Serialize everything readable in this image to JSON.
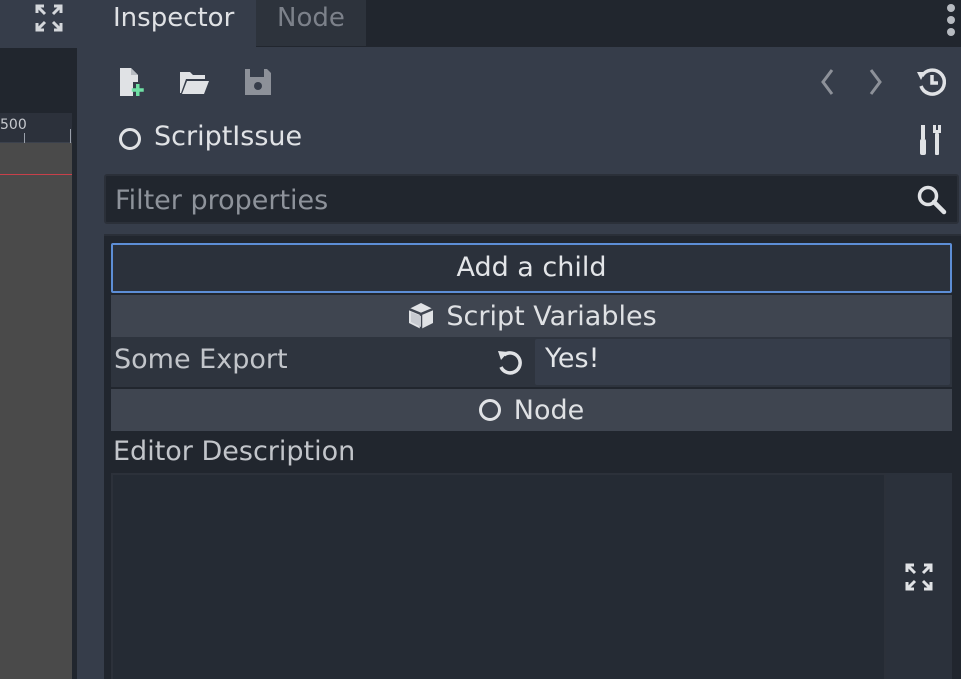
{
  "left_panel": {
    "ruler_value": "500"
  },
  "tabs": [
    {
      "label": "Inspector",
      "active": true
    },
    {
      "label": "Node",
      "active": false
    }
  ],
  "toolbar": {
    "icons": [
      "new-resource-icon",
      "open-folder-icon",
      "save-icon",
      "back-arrow-icon",
      "forward-arrow-icon",
      "history-icon"
    ]
  },
  "object": {
    "name": "ScriptIssue",
    "icon": "node-circle-icon"
  },
  "filter": {
    "placeholder": "Filter properties",
    "value": ""
  },
  "properties": {
    "add_child_label": "Add a child",
    "script_section_label": "Script Variables",
    "export_name": "Some Export",
    "export_value": "Yes!",
    "node_section_label": "Node",
    "editor_description_label": "Editor Description",
    "editor_description_value": ""
  },
  "colors": {
    "accent": "#5d8ed6",
    "new_icon_plus": "#6fe0a4",
    "background": "#363d4a",
    "panel_dark": "#21262e"
  }
}
